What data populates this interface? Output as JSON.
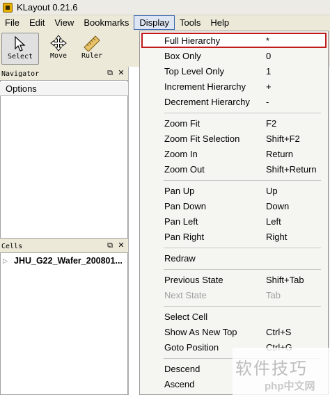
{
  "window": {
    "title": "KLayout 0.21.6"
  },
  "menubar": {
    "items": [
      {
        "label": "File"
      },
      {
        "label": "Edit"
      },
      {
        "label": "View"
      },
      {
        "label": "Bookmarks"
      },
      {
        "label": "Display"
      },
      {
        "label": "Tools"
      },
      {
        "label": "Help"
      }
    ]
  },
  "toolbar": {
    "tools": [
      {
        "label": "Select",
        "icon": "cursor-arrow-icon"
      },
      {
        "label": "Move",
        "icon": "move-arrows-icon"
      },
      {
        "label": "Ruler",
        "icon": "ruler-icon"
      }
    ]
  },
  "navigator": {
    "title": "Navigator",
    "tab_label": "Options"
  },
  "cells": {
    "title": "Cells",
    "root_cell": "JHU_G22_Wafer_200801..."
  },
  "display_menu": {
    "items": [
      {
        "label": "Full Hierarchy",
        "shortcut": "*"
      },
      {
        "label": "Box Only",
        "shortcut": "0"
      },
      {
        "label": "Top Level Only",
        "shortcut": "1"
      },
      {
        "label": "Increment Hierarchy",
        "shortcut": "+"
      },
      {
        "label": "Decrement Hierarchy",
        "shortcut": "-"
      },
      {
        "label": "Zoom Fit",
        "shortcut": "F2"
      },
      {
        "label": "Zoom Fit Selection",
        "shortcut": "Shift+F2"
      },
      {
        "label": "Zoom In",
        "shortcut": "Return"
      },
      {
        "label": "Zoom Out",
        "shortcut": "Shift+Return"
      },
      {
        "label": "Pan Up",
        "shortcut": "Up"
      },
      {
        "label": "Pan Down",
        "shortcut": "Down"
      },
      {
        "label": "Pan Left",
        "shortcut": "Left"
      },
      {
        "label": "Pan Right",
        "shortcut": "Right"
      },
      {
        "label": "Redraw",
        "shortcut": ""
      },
      {
        "label": "Previous State",
        "shortcut": "Shift+Tab"
      },
      {
        "label": "Next State",
        "shortcut": "Tab"
      },
      {
        "label": "Select Cell",
        "shortcut": ""
      },
      {
        "label": "Show As New Top",
        "shortcut": "Ctrl+S"
      },
      {
        "label": "Goto Position",
        "shortcut": "Ctrl+G"
      },
      {
        "label": "Descend",
        "shortcut": ""
      },
      {
        "label": "Ascend",
        "shortcut": ""
      }
    ]
  },
  "watermark": {
    "text": "软件技巧",
    "logo": "php中文网"
  }
}
